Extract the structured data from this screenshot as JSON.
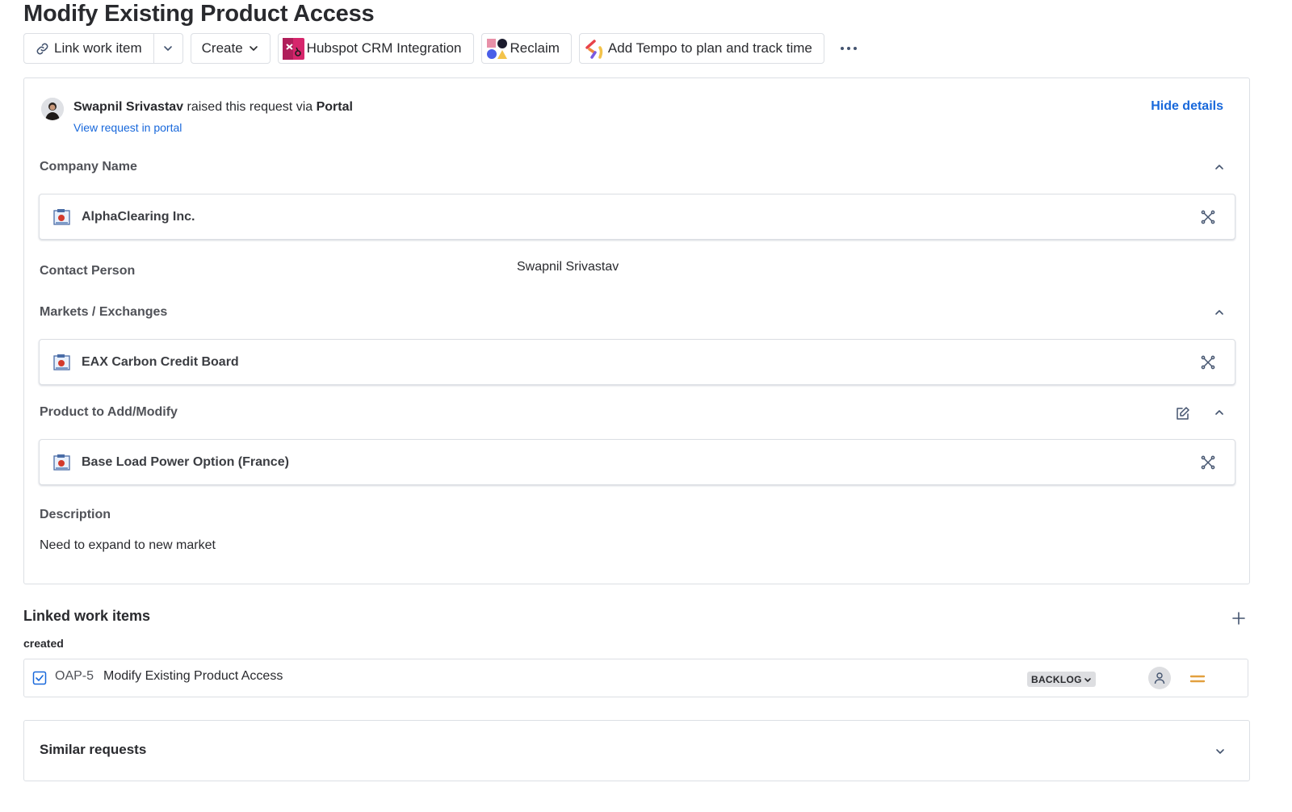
{
  "page": {
    "title": "Modify Existing Product Access"
  },
  "toolbar": {
    "link_work_item": "Link work item",
    "create": "Create",
    "apps": [
      {
        "label": "Hubspot CRM Integration",
        "icon": "hubspot-icon"
      },
      {
        "label": "Reclaim",
        "icon": "reclaim-icon"
      },
      {
        "label": "Add Tempo to plan and track time",
        "icon": "tempo-icon"
      }
    ],
    "more": "···"
  },
  "request": {
    "reporter_name": "Swapnil Srivastav",
    "raised_text": " raised this request via ",
    "channel": "Portal",
    "view_link": "View request in portal",
    "hide_details": "Hide details"
  },
  "fields": {
    "company": {
      "label": "Company Name",
      "value": "AlphaClearing Inc."
    },
    "contact": {
      "label": "Contact Person",
      "value": "Swapnil Srivastav"
    },
    "markets": {
      "label": "Markets / Exchanges",
      "value": "EAX Carbon Credit Board"
    },
    "product": {
      "label": "Product to Add/Modify",
      "value": "Base Load Power Option (France)"
    },
    "description": {
      "label": "Description",
      "value": "Need to expand to new market"
    }
  },
  "linked": {
    "title": "Linked work items",
    "relation": "created",
    "items": [
      {
        "key": "OAP-5",
        "summary": "Modify Existing Product Access",
        "status": "BACKLOG",
        "priority": "medium"
      }
    ]
  },
  "similar": {
    "title": "Similar requests"
  },
  "colors": {
    "link": "#1868db",
    "border": "#dcdfe4",
    "priority_medium": "#e2a03f",
    "hubspot_bg": "#d6266c",
    "task_icon": "#1868db"
  }
}
